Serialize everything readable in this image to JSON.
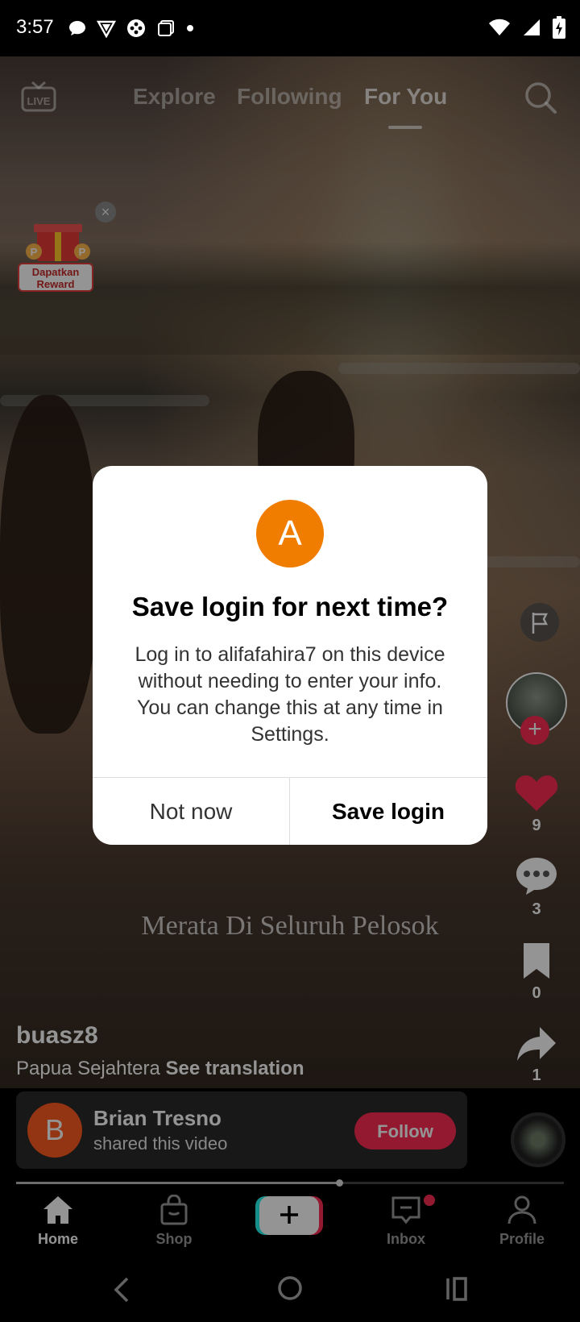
{
  "status_bar": {
    "time": "3:57",
    "left_icons": [
      "chat-bubble-icon",
      "vpn-shield-icon",
      "game-controller-icon",
      "copy-icon",
      "dot-icon"
    ],
    "right_icons": [
      "wifi-icon",
      "cell-signal-icon",
      "battery-charging-icon"
    ]
  },
  "top_nav": {
    "live_icon_text": "LIVE",
    "tabs": [
      {
        "label": "Explore",
        "active": false
      },
      {
        "label": "Following",
        "active": false
      },
      {
        "label": "For You",
        "active": true
      }
    ]
  },
  "reward": {
    "label_line1": "Dapatkan",
    "label_line2": "Reward",
    "close_symbol": "×"
  },
  "video": {
    "caption_overlay": "Merata Di Seluruh Pelosok",
    "author": "buasz8",
    "description": "Papua Sejahtera",
    "see_translation": "See translation",
    "progress_fraction": 0.59
  },
  "side_rail": {
    "likes": "9",
    "comments": "3",
    "saves": "0",
    "shares": "1",
    "follow_plus": "+"
  },
  "shared_by": {
    "avatar_letter": "B",
    "name": "Brian Tresno",
    "subtitle": "shared this video",
    "follow_label": "Follow"
  },
  "bottom_nav": {
    "items": [
      {
        "label": "Home",
        "icon": "home-icon"
      },
      {
        "label": "Shop",
        "icon": "shopping-bag-icon"
      },
      {
        "label": "",
        "icon": "plus-icon"
      },
      {
        "label": "Inbox",
        "icon": "inbox-icon"
      },
      {
        "label": "Profile",
        "icon": "profile-icon"
      }
    ]
  },
  "dialog": {
    "avatar_letter": "A",
    "title": "Save login for next time?",
    "body": "Log in to alifafahira7 on this device without needing to enter your info. You can change this at any time in Settings.",
    "secondary_button": "Not now",
    "primary_button": "Save login"
  },
  "colors": {
    "accent": "#fe2c55",
    "dialog_avatar": "#f17d00",
    "shared_avatar": "#fe5a1f"
  }
}
